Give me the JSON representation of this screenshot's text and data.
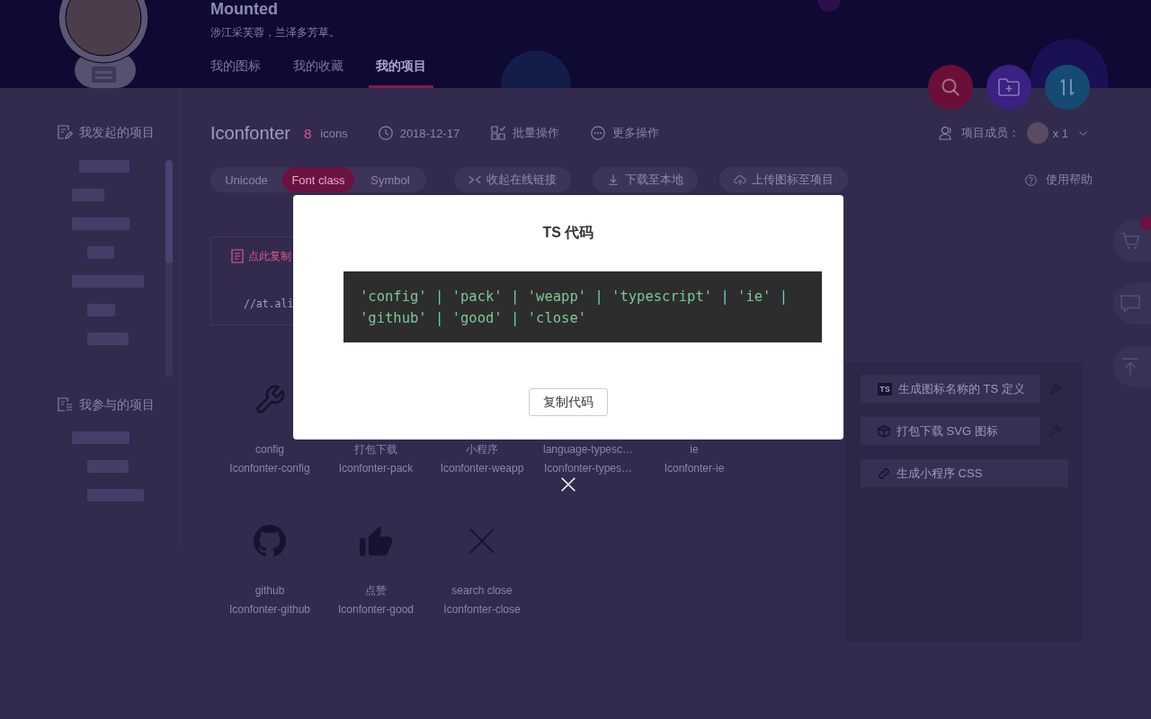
{
  "header": {
    "title": "Mounted",
    "subtitle": "涉江采芙蓉，兰泽多芳草。",
    "tabs": [
      {
        "label": "我的图标",
        "selected": false
      },
      {
        "label": "我的收藏",
        "selected": false
      },
      {
        "label": "我的项目",
        "selected": true
      }
    ]
  },
  "action_buttons": [
    {
      "kind": "search",
      "color": "#6a0f38"
    },
    {
      "kind": "new-folder",
      "color": "#3b2182"
    },
    {
      "kind": "sort",
      "color": "#154a73"
    }
  ],
  "sidebar": {
    "sections": [
      {
        "kind": "started",
        "title": "我发起的项目"
      },
      {
        "kind": "joined",
        "title": "我参与的项目"
      }
    ]
  },
  "project": {
    "name": "Iconfonter",
    "icon_count": "8",
    "icon_unit": "icons",
    "date": "2018-12-17",
    "actions": [
      {
        "kind": "batch",
        "label": "批量操作"
      },
      {
        "kind": "more",
        "label": "更多操作"
      }
    ],
    "members_label": "项目成员：",
    "members_count": "x 1"
  },
  "font_tabs": [
    {
      "label": "Unicode",
      "selected": false
    },
    {
      "label": "Font class",
      "selected": true
    },
    {
      "label": "Symbol",
      "selected": false
    }
  ],
  "toolbar": [
    {
      "kind": "collapse",
      "label": "收起在线链接"
    },
    {
      "kind": "download",
      "label": "下载至本地"
    },
    {
      "kind": "upload",
      "label": "上传图标至项目"
    }
  ],
  "help": "使用帮助",
  "code_card": {
    "copy_label": "点此复制",
    "code": "//at.ali"
  },
  "icons": [
    {
      "kind": "wrench",
      "name": "config",
      "class_name": "Iconfonter-config"
    },
    {
      "name": "打包下载",
      "class_name": "Iconfonter-pack"
    },
    {
      "name": "小程序",
      "class_name": "Iconfonter-weapp"
    },
    {
      "name": "language-typesc…",
      "class_name": "Iconfonter-types…"
    },
    {
      "name": "ie",
      "class_name": "Iconfonter-ie"
    },
    {
      "kind": "github",
      "name": "github",
      "class_name": "Iconfonter-github"
    },
    {
      "kind": "thumbs-up",
      "name": "点赞",
      "class_name": "Iconfonter-good"
    },
    {
      "kind": "cross",
      "name": "search close",
      "class_name": "Iconfonter-close"
    }
  ],
  "tools": [
    {
      "kind": "ts",
      "logo": "TS",
      "label": "生成图标名称的 TS 定义",
      "configurable": true
    },
    {
      "kind": "package",
      "label": "打包下载 SVG 图标",
      "configurable": true
    },
    {
      "kind": "link",
      "label": "生成小程序 CSS",
      "configurable": false
    }
  ],
  "side_buttons": [
    {
      "kind": "cart",
      "badge": true
    },
    {
      "kind": "chat",
      "badge": false
    },
    {
      "kind": "top",
      "badge": false
    }
  ],
  "modal": {
    "title": "TS 代码",
    "code_lines": [
      [
        {
          "kind": "string",
          "text": "'config'"
        },
        {
          "kind": "operator",
          "text": "|"
        },
        {
          "kind": "string",
          "text": "'pack'"
        },
        {
          "kind": "operator",
          "text": "|"
        },
        {
          "kind": "string",
          "text": "'weapp'"
        },
        {
          "kind": "operator",
          "text": "|"
        },
        {
          "kind": "string",
          "text": "'typescript'"
        },
        {
          "kind": "operator",
          "text": "|"
        },
        {
          "kind": "string",
          "text": "'ie'"
        },
        {
          "kind": "operator",
          "text": "|"
        }
      ],
      [
        {
          "kind": "string",
          "text": "'github'"
        },
        {
          "kind": "operator",
          "text": "|"
        },
        {
          "kind": "string",
          "text": "'good'"
        },
        {
          "kind": "operator",
          "text": "|"
        },
        {
          "kind": "string",
          "text": "'close'"
        }
      ]
    ],
    "button": "复制代码"
  }
}
